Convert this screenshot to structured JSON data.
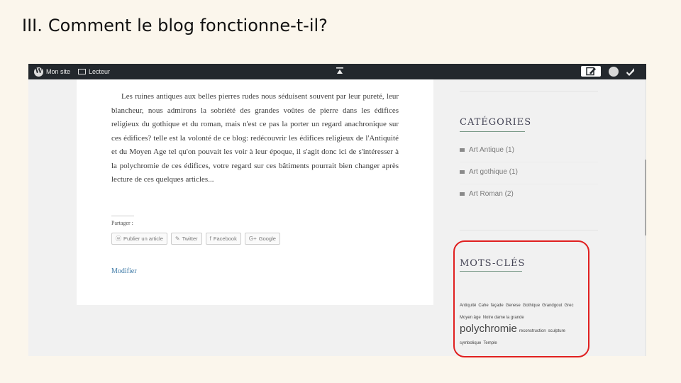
{
  "slide": {
    "roman": "III.",
    "title": "Comment le blog fonctionne-t-il?"
  },
  "adminbar": {
    "site_label": "Mon site",
    "reader_label": "Lecteur",
    "wp_logo_icon": "wordpress-icon",
    "reader_icon": "reader-icon",
    "center_icon": "collapse-arrow-icon",
    "write_icon": "write-post-icon",
    "avatar_icon": "user-avatar-icon",
    "notifications_icon": "notifications-icon"
  },
  "post": {
    "body": "Les ruines antiques aux belles pierres rudes nous séduisent souvent par leur pureté, leur blancheur, nous admirons la sobriété des grandes voûtes de pierre dans les édifices religieux du gothique et du roman, mais n'est ce pas la porter un regard anachronique sur ces édifices? telle est la volonté de ce blog: redécouvrir les édifices religieux de l'Antiquité et du Moyen Age tel qu'on pouvait les voir à leur époque, il s'agit donc ici de s'intéresser à la polychromie de ces édifices, votre regard sur ces bâtiments pourrait bien changer après lecture de ces quelques articles...",
    "share_label": "Partager :",
    "share_buttons": [
      {
        "label": "Publier un article",
        "icon": "wordpress-icon"
      },
      {
        "label": "Twitter",
        "icon": "twitter-icon"
      },
      {
        "label": "Facebook",
        "icon": "facebook-icon"
      },
      {
        "label": "Google",
        "icon": "google-plus-icon"
      }
    ],
    "edit_label": "Modifier"
  },
  "sidebar": {
    "categories_title": "CATÉGORIES",
    "categories": [
      {
        "label": "Art Antique (1)"
      },
      {
        "label": "Art gothique (1)"
      },
      {
        "label": "Art Roman (2)"
      }
    ],
    "tags_title": "MOTS-CLÉS",
    "tags": [
      {
        "label": "Antiquité",
        "size": "sm"
      },
      {
        "label": "Cahe",
        "size": "sm"
      },
      {
        "label": "façade",
        "size": "sm"
      },
      {
        "label": "Genese",
        "size": "sm"
      },
      {
        "label": "Gothique",
        "size": "sm"
      },
      {
        "label": "Grandgout",
        "size": "sm"
      },
      {
        "label": "Grec",
        "size": "sm"
      },
      {
        "label": "Moyen âge",
        "size": "sm"
      },
      {
        "label": "Notre dame la grande",
        "size": "sm"
      },
      {
        "label": "polychromie",
        "size": "lg"
      },
      {
        "label": "reconstruction",
        "size": "sm"
      },
      {
        "label": "sculpture",
        "size": "sm"
      },
      {
        "label": "symbolique",
        "size": "sm"
      },
      {
        "label": "Temple",
        "size": "sm"
      }
    ]
  },
  "colors": {
    "admin_bar": "#23282d",
    "highlight": "#e02020",
    "link": "#3b78a5",
    "widget_underline": "#7a9a88"
  }
}
